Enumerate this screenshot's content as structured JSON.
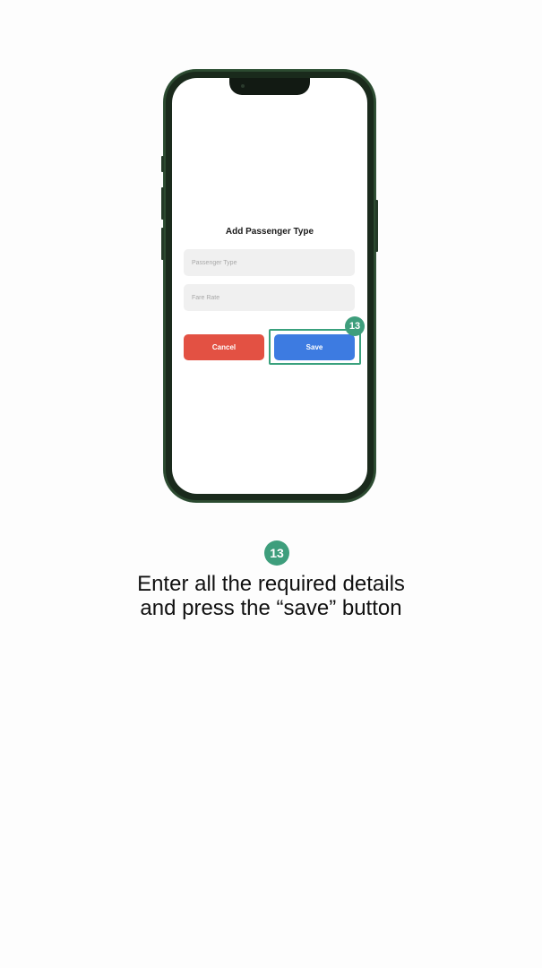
{
  "dialog": {
    "title": "Add Passenger Type",
    "passenger_type_placeholder": "Passenger Type",
    "passenger_type_value": "",
    "fare_rate_placeholder": "Fare Rate",
    "fare_rate_value": "",
    "cancel_label": "Cancel",
    "save_label": "Save"
  },
  "step": {
    "number": "13",
    "instruction_line1": "Enter all the required details",
    "instruction_line2": "and press the “save” button"
  },
  "colors": {
    "cancel": "#e35143",
    "save": "#3d7be1",
    "highlight": "#3aa17d",
    "badge": "#3e9e7c",
    "phone_frame": "#1a2a1c"
  },
  "icons": {
    "step_badge": "numbered-step-badge"
  }
}
